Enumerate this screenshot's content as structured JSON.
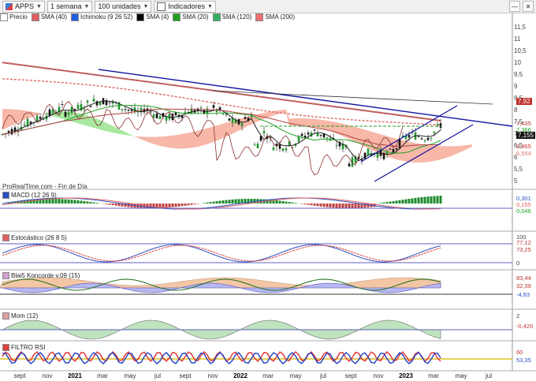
{
  "toolbar": {
    "ticker": "APPS",
    "timeframe": "1 semana",
    "units": "100 unidades",
    "indicators": "Indicadores"
  },
  "legend": [
    {
      "label": "Precio",
      "color": "#ffffff"
    },
    {
      "label": "SMA (40)",
      "color": "#e06060"
    },
    {
      "label": "Ichimoku (9 26 52)",
      "color": "#2060e0"
    },
    {
      "label": "SMA (4)",
      "color": "#000000"
    },
    {
      "label": "SMA (20)",
      "color": "#20a020"
    },
    {
      "label": "SMA (120)",
      "color": "#30b060"
    },
    {
      "label": "SMA (200)",
      "color": "#f07070"
    }
  ],
  "price_scale": [
    "11,5",
    "11",
    "10,5",
    "10",
    "9,5",
    "9",
    "8,5",
    "8",
    "7,5",
    "7",
    "6,5",
    "6",
    "5,5",
    "5"
  ],
  "price_tags": {
    "close": "7,155",
    "high": "7,92",
    "v1": "7,435",
    "v2": "7,366",
    "v3": "6,865",
    "v4": "6,554"
  },
  "source": "ProRealTime.com - Fin de Día",
  "panels": {
    "macd": {
      "title": "MACD (12 26 9)",
      "values": [
        "0,301",
        "0,155",
        "0,046"
      ]
    },
    "stoch": {
      "title": "Estocástico (26 8 5)",
      "values": [
        "100",
        "77,12",
        "73,25",
        "0"
      ]
    },
    "blai": {
      "title": "Blai5 Koncorde v.09 (15)",
      "values": [
        "83,44",
        "32,39",
        "-4,83"
      ]
    },
    "mom": {
      "title": "Mom (12)",
      "values": [
        "2",
        "-0,420"
      ]
    },
    "rsi": {
      "title": "FILTRO RSI",
      "values": [
        "60",
        "53,35"
      ]
    }
  },
  "x_axis": [
    {
      "label": "sept",
      "bold": false
    },
    {
      "label": "nov",
      "bold": false
    },
    {
      "label": "2021",
      "bold": true
    },
    {
      "label": "mar",
      "bold": false
    },
    {
      "label": "may",
      "bold": false
    },
    {
      "label": "jul",
      "bold": false
    },
    {
      "label": "sept",
      "bold": false
    },
    {
      "label": "nov",
      "bold": false
    },
    {
      "label": "2022",
      "bold": true
    },
    {
      "label": "mar",
      "bold": false
    },
    {
      "label": "may",
      "bold": false
    },
    {
      "label": "jul",
      "bold": false
    },
    {
      "label": "sept",
      "bold": false
    },
    {
      "label": "nov",
      "bold": false
    },
    {
      "label": "2023",
      "bold": true
    },
    {
      "label": "mar",
      "bold": false
    },
    {
      "label": "may",
      "bold": false
    },
    {
      "label": "jul",
      "bold": false
    }
  ],
  "colors": {
    "up": "#1a9a2a",
    "down": "#111111",
    "cloud_red": "#f7b8a8",
    "cloud_green": "#a8e8a0",
    "trend": "#1010a0"
  }
}
